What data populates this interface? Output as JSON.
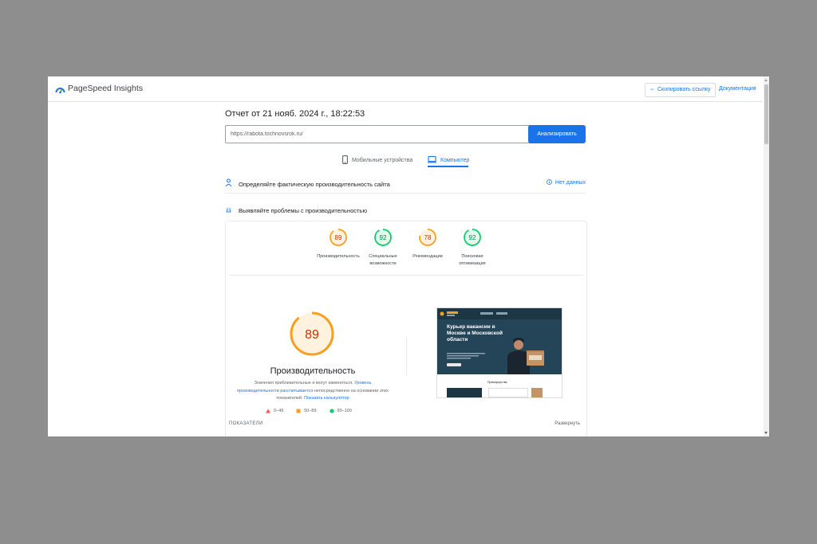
{
  "app": {
    "brand": "PageSpeed Insights",
    "copy_link": "Скопировать ссылку",
    "docs": "Документация"
  },
  "report": {
    "title": "Отчет от 21 нояб. 2024 г., 18:22:53",
    "url_value": "https://rabota.tochnovsrok.ru/",
    "analyze_label": "Анализировать"
  },
  "tabs": [
    {
      "label": "Мобильные устройства",
      "icon": "smartphone-icon",
      "active": false
    },
    {
      "label": "Компьютер",
      "icon": "desktop-icon",
      "active": true
    }
  ],
  "sections": {
    "field_data": "Определяйте фактическую производительность сайта",
    "no_data": "Нет данных",
    "lab_data": "Выявляйте проблемы с производительностью"
  },
  "scores": [
    {
      "value": "89",
      "label_line1": "Производительность",
      "label_line2": "",
      "color": "#fa9f1c"
    },
    {
      "value": "92",
      "label_line1": "Специальные",
      "label_line2": "возможности",
      "color": "#0cce6b"
    },
    {
      "value": "78",
      "label_line1": "Рекомендации",
      "label_line2": "",
      "color": "#fa9f1c"
    },
    {
      "value": "92",
      "label_line1": "Поисковая",
      "label_line2": "оптимизация",
      "color": "#0cce6b"
    }
  ],
  "performance": {
    "score": "89",
    "title": "Производительность",
    "desc_part1": "Значения приблизительные и могут изменяться. ",
    "desc_link1": "Уровень производительности рассчитывается",
    "desc_part2": " непосредственно на основании этих показателей. ",
    "desc_link2": "Показать калькулятор",
    "colors": {
      "fail": "#ff4e42",
      "average": "#fa9f1c",
      "pass": "#0cce6b"
    }
  },
  "legend": [
    {
      "label": "0–49",
      "shape": "triangle"
    },
    {
      "label": "50–89",
      "shape": "square"
    },
    {
      "label": "90–100",
      "shape": "circle"
    }
  ],
  "bottom": {
    "indicators": "ПОКАЗАТЕЛИ",
    "expand": "Развернуть"
  },
  "preview": {
    "hero_text": "Курьер вакансии в Москве и Московской области",
    "sub_text": "Преимущества"
  }
}
